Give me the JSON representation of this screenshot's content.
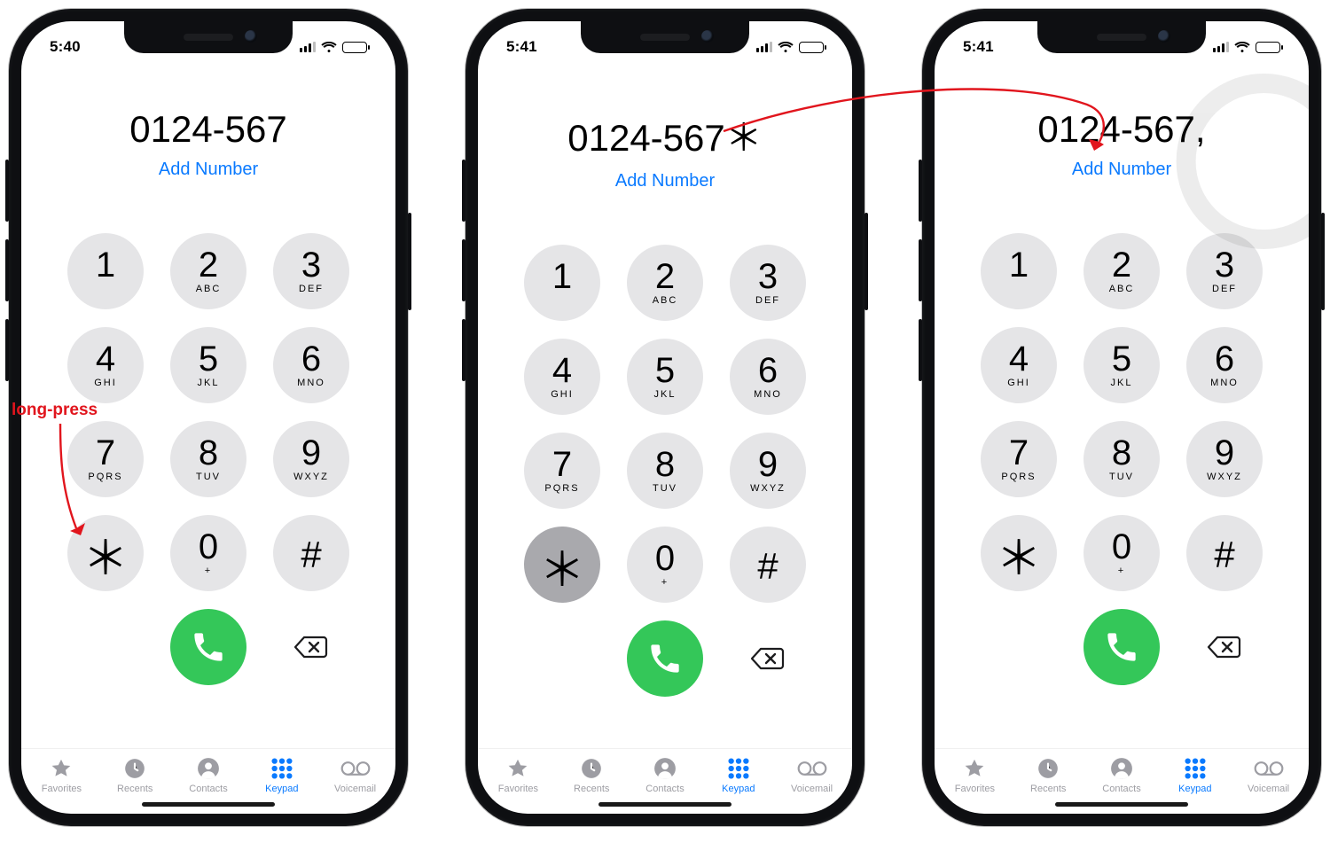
{
  "annotation": {
    "long_press": "long-press"
  },
  "phones": [
    {
      "time": "5:40",
      "dialed": "0124-567",
      "add_number": "Add Number",
      "star_pressed": false,
      "show_watermark": false
    },
    {
      "time": "5:41",
      "dialed": "0124-567＊",
      "add_number": "Add Number",
      "star_pressed": true,
      "show_watermark": false
    },
    {
      "time": "5:41",
      "dialed": "0124-567,",
      "add_number": "Add Number",
      "star_pressed": false,
      "show_watermark": true
    }
  ],
  "keys": [
    {
      "digit": "1",
      "sub": "",
      "name": "key-1"
    },
    {
      "digit": "2",
      "sub": "ABC",
      "name": "key-2"
    },
    {
      "digit": "3",
      "sub": "DEF",
      "name": "key-3"
    },
    {
      "digit": "4",
      "sub": "GHI",
      "name": "key-4"
    },
    {
      "digit": "5",
      "sub": "JKL",
      "name": "key-5"
    },
    {
      "digit": "6",
      "sub": "MNO",
      "name": "key-6"
    },
    {
      "digit": "7",
      "sub": "PQRS",
      "name": "key-7"
    },
    {
      "digit": "8",
      "sub": "TUV",
      "name": "key-8"
    },
    {
      "digit": "9",
      "sub": "WXYZ",
      "name": "key-9"
    },
    {
      "digit": "＊",
      "sub": "",
      "name": "key-star",
      "sym": "star"
    },
    {
      "digit": "0",
      "sub": "+",
      "name": "key-0"
    },
    {
      "digit": "#",
      "sub": "",
      "name": "key-hash",
      "sym": "hash"
    }
  ],
  "tabs": [
    {
      "label": "Favorites",
      "name": "tab-favorites",
      "icon": "star"
    },
    {
      "label": "Recents",
      "name": "tab-recents",
      "icon": "clock"
    },
    {
      "label": "Contacts",
      "name": "tab-contacts",
      "icon": "person"
    },
    {
      "label": "Keypad",
      "name": "tab-keypad",
      "icon": "keypad",
      "active": true
    },
    {
      "label": "Voicemail",
      "name": "tab-voicemail",
      "icon": "voicemail"
    }
  ]
}
